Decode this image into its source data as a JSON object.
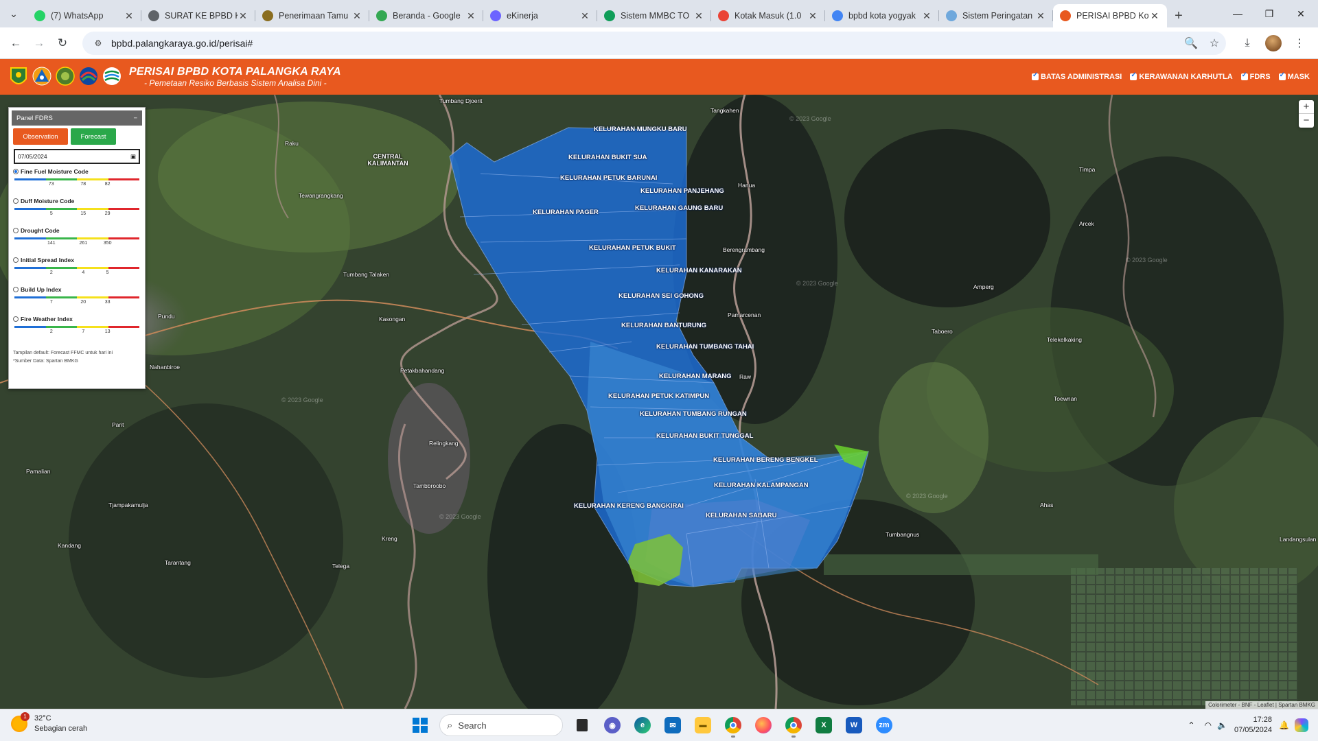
{
  "browser": {
    "tabs": [
      {
        "title": "(7) WhatsApp",
        "color": "#25d366",
        "active": false
      },
      {
        "title": "SURAT KE BPBD K",
        "color": "#5f6368",
        "active": false
      },
      {
        "title": "Penerimaan Tamu",
        "color": "#8a6d1f",
        "active": false
      },
      {
        "title": "Beranda - Google",
        "color": "#34a853",
        "active": false
      },
      {
        "title": "eKinerja",
        "color": "#6c63ff",
        "active": false
      },
      {
        "title": "Sistem MMBC TO",
        "color": "#0f9d58",
        "active": false
      },
      {
        "title": "Kotak Masuk (1.0",
        "color": "#ea4335",
        "active": false
      },
      {
        "title": "bpbd kota yogyak",
        "color": "#4285f4",
        "active": false
      },
      {
        "title": "Sistem Peringatan",
        "color": "#6fa8dc",
        "active": false
      },
      {
        "title": "PERISAI BPBD Kot",
        "color": "#e8591f",
        "active": true
      }
    ],
    "url": "bpbd.palangkaraya.go.id/perisai#"
  },
  "header": {
    "title": "PERISAI BPBD KOTA PALANGKA RAYA",
    "subtitle": "- Pemetaan Resiko Berbasis Sistem Analisa Dini -",
    "layers": [
      "BATAS ADMINISTRASI",
      "KERAWANAN KARHUTLA",
      "FDRS",
      "MASK"
    ]
  },
  "panel": {
    "title": "Panel FDRS",
    "collapse": "−",
    "observation_label": "Observation",
    "forecast_label": "Forecast",
    "date_value": "07/05/2024",
    "indices": [
      {
        "name": "Fine Fuel Moisture Code",
        "selected": true,
        "ticks": [
          "73",
          "78",
          "82"
        ]
      },
      {
        "name": "Duff Moisture Code",
        "selected": false,
        "ticks": [
          "5",
          "15",
          "29"
        ]
      },
      {
        "name": "Drought Code",
        "selected": false,
        "ticks": [
          "141",
          "261",
          "350"
        ]
      },
      {
        "name": "Initial Spread Index",
        "selected": false,
        "ticks": [
          "2",
          "4",
          "5"
        ]
      },
      {
        "name": "Build Up Index",
        "selected": false,
        "ticks": [
          "7",
          "20",
          "33"
        ]
      },
      {
        "name": "Fire Weather Index",
        "selected": false,
        "ticks": [
          "2",
          "7",
          "13"
        ]
      }
    ],
    "scale_colors": [
      "#1f6fd6",
      "#39b54a",
      "#f5e11c",
      "#e0262c"
    ],
    "note1": "Tampilan default: Forecast FFMC untuk hari ini",
    "note2": "*Sumber Data: Spartan BMKG"
  },
  "map": {
    "kelurahan": [
      "KELURAHAN MUNGKU BARU",
      "KELURAHAN BUKIT SUA",
      "KELURAHAN PETUK BARUNAI",
      "KELURAHAN PANJEHANG",
      "KELURAHAN GAUNG BARU",
      "KELURAHAN PAGER",
      "KELURAHAN PETUK BUKIT",
      "KELURAHAN KANARAKAN",
      "KELURAHAN SEI GOHONG",
      "KELURAHAN BANTURUNG",
      "KELURAHAN TUMBANG TAHAI",
      "KELURAHAN MARANG",
      "KELURAHAN PETUK KATIMPUN",
      "KELURAHAN TUMBANG RUNGAN",
      "KELURAHAN BUKIT TUNGGAL",
      "KELURAHAN BERENG BENGKEL",
      "KELURAHAN KALAMPANGAN",
      "KELURAHAN KERENG BANGKIRAI",
      "KELURAHAN SABARU"
    ],
    "places": [
      "Tumbang Djoerit",
      "Tangkahen",
      "Raku",
      "CENTRAL KALIMANTAN",
      "Tewangrangkang",
      "Timpa",
      "Hanua",
      "Arcek",
      "Berengrambang",
      "Tumbang Talaken",
      "Amperg",
      "Pundu",
      "Kasongan",
      "Pamarcenan",
      "Taboero",
      "Telekelkaking",
      "Nahanbiroe",
      "Petakbahandang",
      "Raw",
      "Toewnan",
      "Parit",
      "Relingkang",
      "Pamalian",
      "Tambbroobo",
      "Tjampakamulja",
      "Ahas",
      "Kandang",
      "Kreng",
      "Tumbangnus",
      "Landangsulan",
      "Tarantang",
      "Telega"
    ],
    "watermark": "© 2023 Google",
    "attribution": "Colorimeter - BNF - Leaflet | Spartan BMKG",
    "zoom_in": "+",
    "zoom_out": "−"
  },
  "taskbar": {
    "temp": "32°C",
    "weather": "Sebagian cerah",
    "weather_badge": "1",
    "search": "Search",
    "time": "17:28",
    "date": "07/05/2024"
  }
}
